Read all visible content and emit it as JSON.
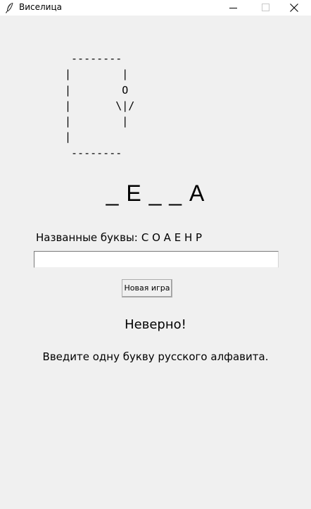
{
  "window": {
    "title": "Виселица",
    "icon": "feather-icon",
    "controls": [
      "minimize-icon",
      "maximize-icon",
      "close-icon"
    ]
  },
  "gallows_art": " --------\n|        |\n|        O\n|       \\|/\n|        |\n|\n --------",
  "word": "_ Е _ _ А",
  "guessed": {
    "label": "Названные буквы:",
    "letters": "С О А Е Н Р"
  },
  "entry": {
    "value": ""
  },
  "new_game_button": "Новая игра",
  "result_message": "Неверно!",
  "hint_message": "Введите одну букву русского алфавита."
}
